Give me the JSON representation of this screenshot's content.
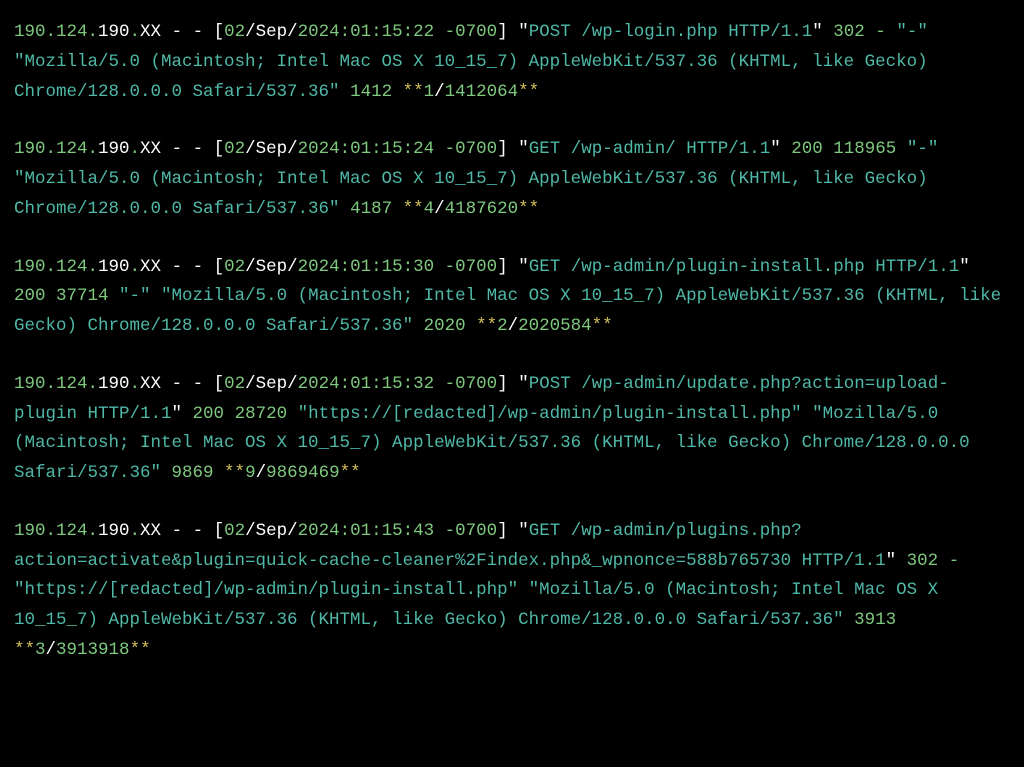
{
  "entries": [
    {
      "ip1": "190.124.",
      "ip2": "190.",
      "ip3": "XX",
      "sep1": " - - [",
      "day": "02",
      "slash1": "/",
      "month": "Sep",
      "slash2": "/",
      "year": "2024:01:15:22",
      "tz": " -0700",
      "close": "] ",
      "reqopen": "\"",
      "request": "POST /wp-login.php HTTP/1.1",
      "reqclose": "\"",
      "status": " 302 ",
      "size": "-",
      "ref": " \"-\" ",
      "ua": "\"Mozilla/5.0 (Macintosh; Intel Mac OS X 10_15_7) AppleWebKit/537.36 (KHTML, like Gecko) Chrome/128.0.0.0 Safari/537.36\"",
      "time1": " 1412 ",
      "stars1": "**",
      "n1": "1",
      "slash3": "/",
      "n2": "1412064",
      "stars2": "**"
    },
    {
      "ip1": "190.124.",
      "ip2": "190.",
      "ip3": "XX",
      "sep1": " - - [",
      "day": "02",
      "slash1": "/",
      "month": "Sep",
      "slash2": "/",
      "year": "2024:01:15:24",
      "tz": " -0700",
      "close": "] ",
      "reqopen": "\"",
      "request": "GET /wp-admin/ HTTP/1.1",
      "reqclose": "\"",
      "status": " 200 ",
      "size": "118965",
      "ref": " \"-\" ",
      "ua": "\"Mozilla/5.0 (Macintosh; Intel Mac OS X 10_15_7) AppleWebKit/537.36 (KHTML, like Gecko) Chrome/128.0.0.0 Safari/537.36\"",
      "time1": " 4187 ",
      "stars1": "**",
      "n1": "4",
      "slash3": "/",
      "n2": "4187620",
      "stars2": "**"
    },
    {
      "ip1": "190.124.",
      "ip2": "190.",
      "ip3": "XX",
      "sep1": " - - [",
      "day": "02",
      "slash1": "/",
      "month": "Sep",
      "slash2": "/",
      "year": "2024:01:15:30",
      "tz": " -0700",
      "close": "] ",
      "reqopen": "\"",
      "request": "GET /wp-admin/plugin-install.php HTTP/1.1",
      "reqclose": "\"",
      "status": " 200 ",
      "size": "37714",
      "ref": " \"-\" ",
      "ua": "\"Mozilla/5.0 (Macintosh; Intel Mac OS X 10_15_7) AppleWebKit/537.36 (KHTML, like Gecko) Chrome/128.0.0.0 Safari/537.36\"",
      "time1": " 2020 ",
      "stars1": "**",
      "n1": "2",
      "slash3": "/",
      "n2": "2020584",
      "stars2": "**"
    },
    {
      "ip1": "190.124.",
      "ip2": "190.",
      "ip3": "XX",
      "sep1": " - - [",
      "day": "02",
      "slash1": "/",
      "month": "Sep",
      "slash2": "/",
      "year": "2024:01:15:32",
      "tz": " -0700",
      "close": "] ",
      "reqopen": "\"",
      "request": "POST /wp-admin/update.php?action=upload-plugin HTTP/1.1",
      "reqclose": "\"",
      "status": " 200 ",
      "size": "28720",
      "ref": " \"https://[redacted]/wp-admin/plugin-install.php\" ",
      "ua": "\"Mozilla/5.0 (Macintosh; Intel Mac OS X 10_15_7) AppleWebKit/537.36 (KHTML, like Gecko) Chrome/128.0.0.0 Safari/537.36\"",
      "time1": " 9869 ",
      "stars1": "**",
      "n1": "9",
      "slash3": "/",
      "n2": "9869469",
      "stars2": "**"
    },
    {
      "ip1": "190.124.",
      "ip2": "190.",
      "ip3": "XX",
      "sep1": " - - [",
      "day": "02",
      "slash1": "/",
      "month": "Sep",
      "slash2": "/",
      "year": "2024:01:15:43",
      "tz": " -0700",
      "close": "] ",
      "reqopen": "\"",
      "request": "GET /wp-admin/plugins.php?action=activate&plugin=quick-cache-cleaner%2Findex.php&_wpnonce=588b765730 HTTP/1.1",
      "reqclose": "\"",
      "status": " 302 ",
      "size": "-",
      "ref": " \"https://[redacted]/wp-admin/plugin-install.php\" ",
      "ua": "\"Mozilla/5.0 (Macintosh; Intel Mac OS X 10_15_7) AppleWebKit/537.36 (KHTML, like Gecko) Chrome/128.0.0.0 Safari/537.36\"",
      "time1": " 3913 ",
      "stars1": "**",
      "n1": "3",
      "slash3": "/",
      "n2": "3913918",
      "stars2": "**"
    }
  ]
}
